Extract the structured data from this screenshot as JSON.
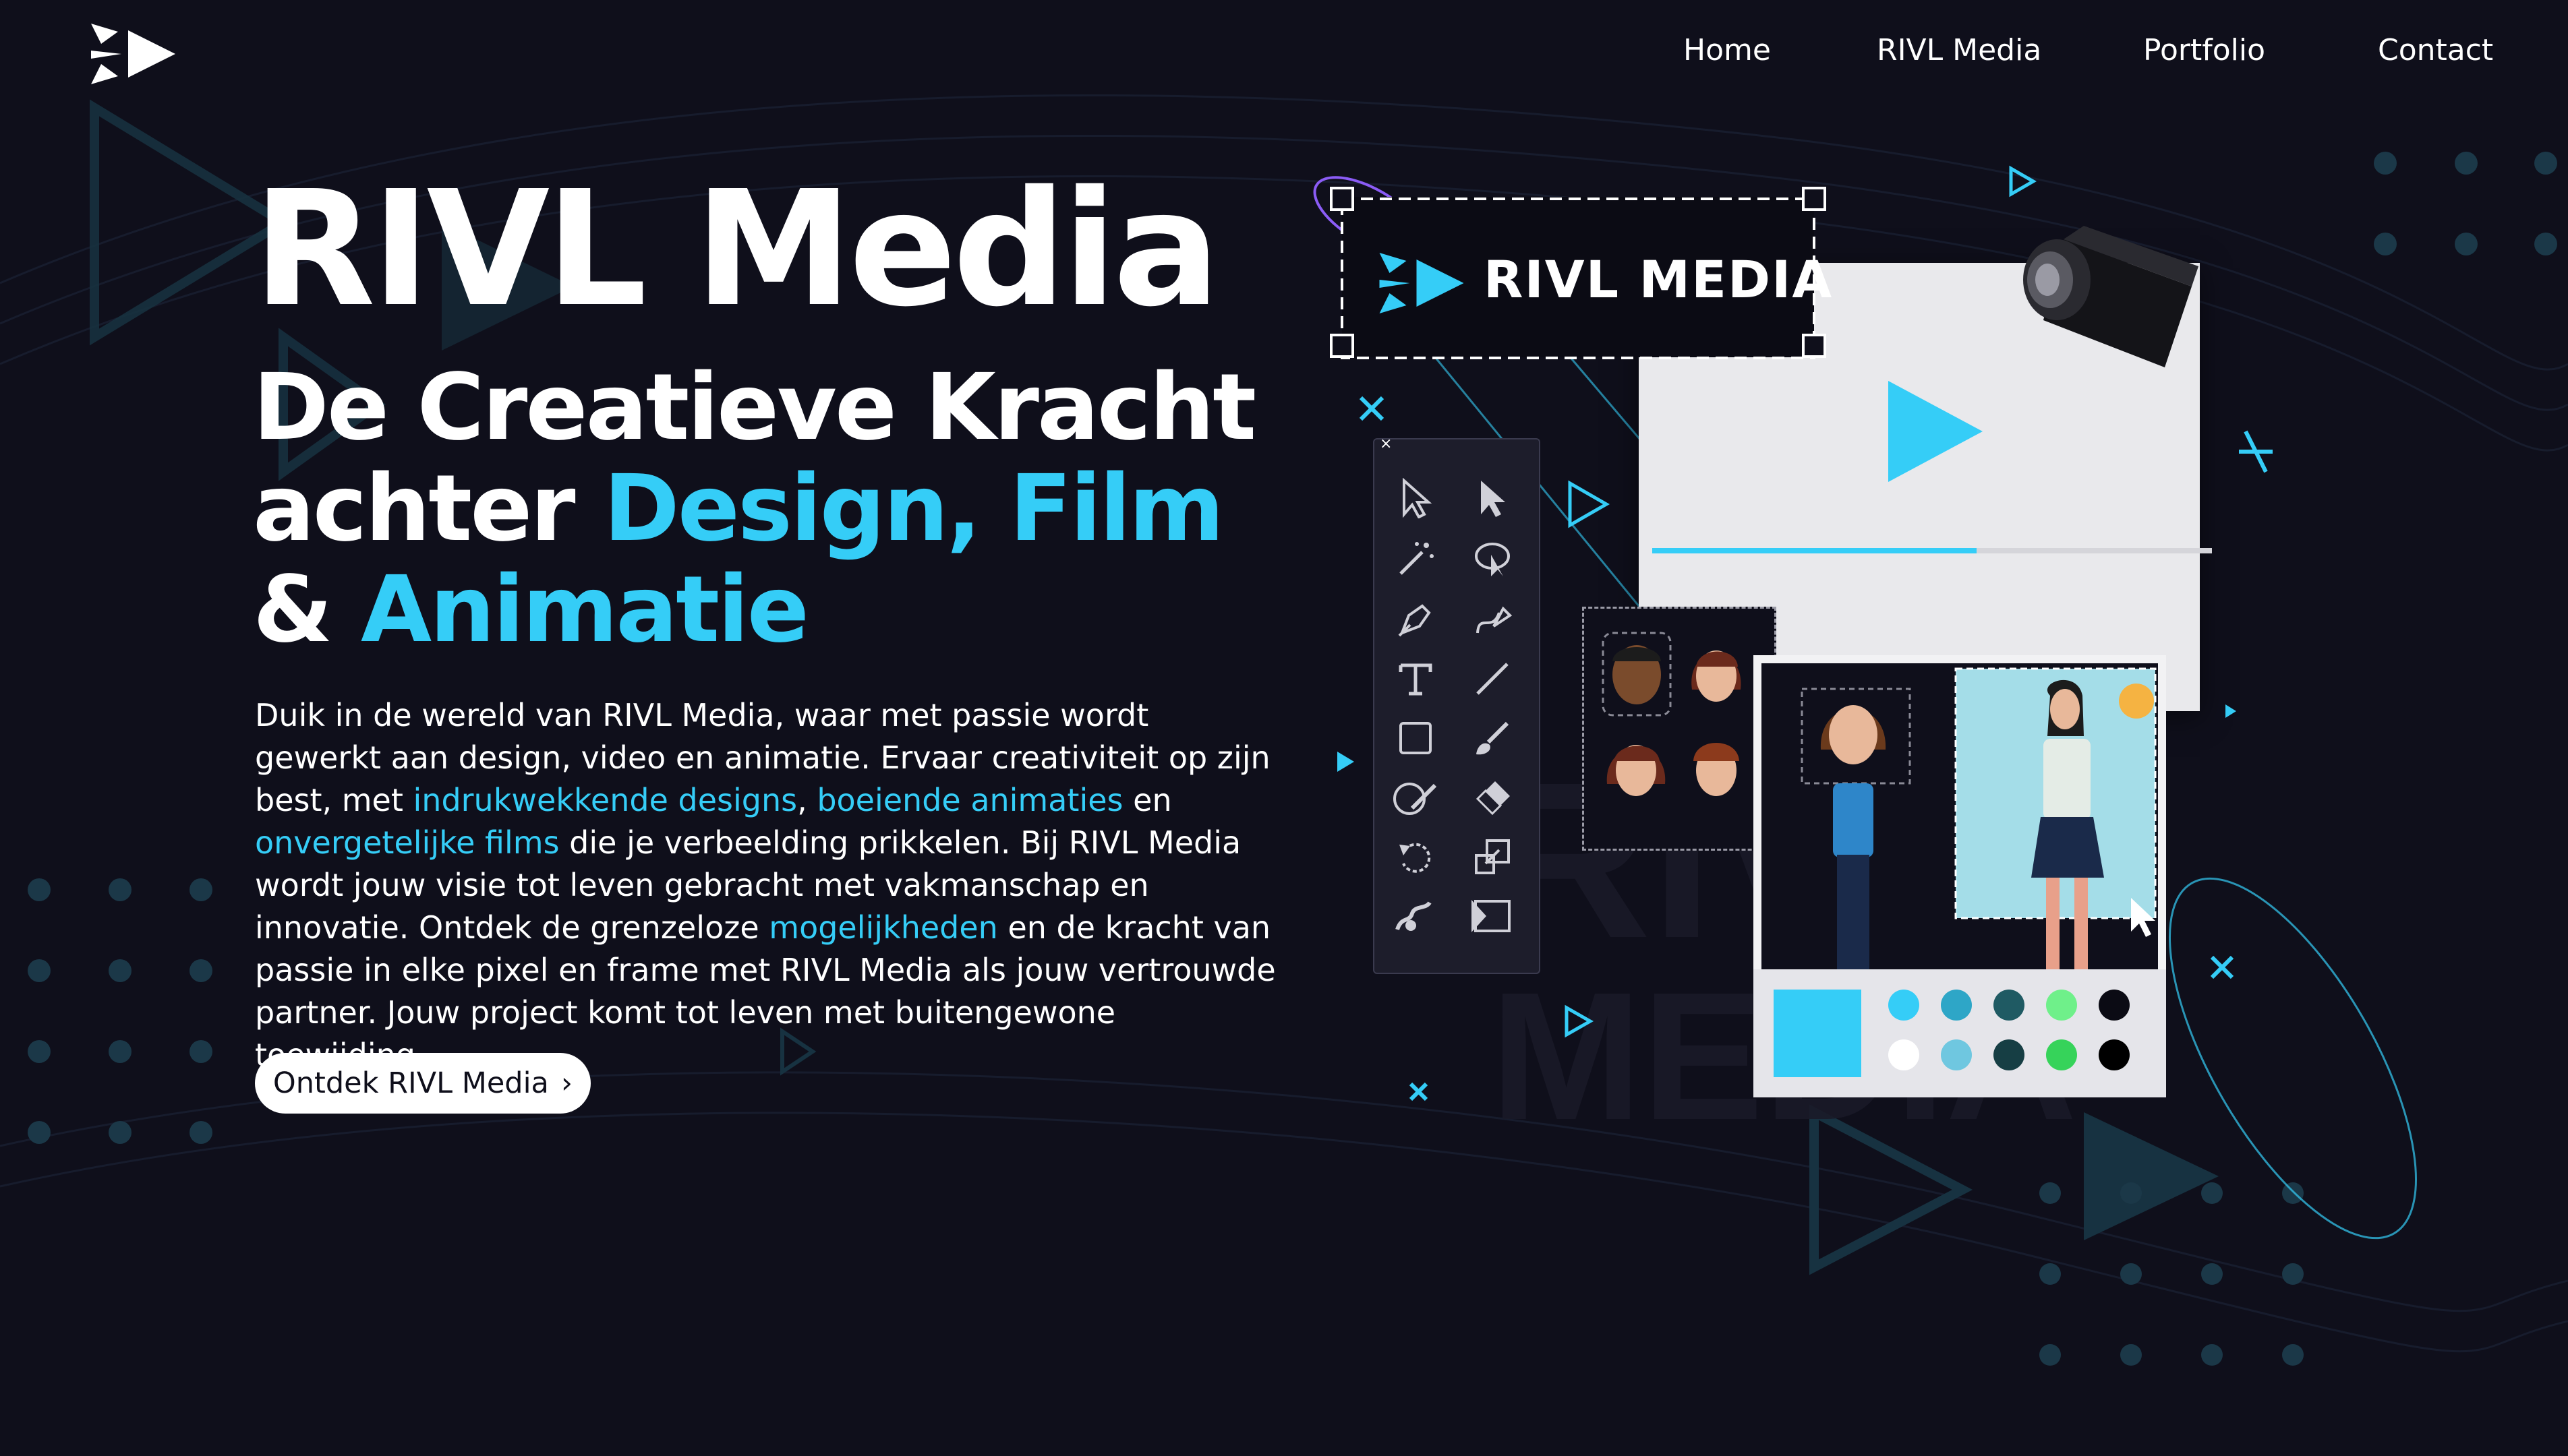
{
  "nav": {
    "home": "Home",
    "rivl_media": "RIVL Media",
    "portfolio": "Portfolio",
    "contact": "Contact"
  },
  "hero": {
    "title": "RIVL Media",
    "subtitle_part1": "De Creatieve Kracht achter ",
    "subtitle_accent1": "Design, Film",
    "subtitle_part2": " & ",
    "subtitle_accent2": "Animatie",
    "body_1": "Duik in de wereld van RIVL Media, waar met passie wordt gewerkt aan design, video en animatie. Ervaar creativiteit op zijn best, met ",
    "link_designs": "indrukwekkende designs",
    "body_sep1": ", ",
    "link_animaties": "boeiende animaties",
    "body_sep2": " en ",
    "link_films": "onvergetelijke films",
    "body_2": " die je verbeelding prikkelen. Bij RIVL Media wordt jouw visie tot leven gebracht met vakmanschap en innovatie. Ontdek de grenzeloze ",
    "link_mogelijkheden": "mogelijkheden",
    "body_3": " en de kracht van passie in elke pixel en frame met RIVL Media als jouw vertrouwde partner. Jouw project komt tot leven met buitengewone toewijding.",
    "cta_label": "Ontdek RIVL Media",
    "cta_arrow": "›"
  },
  "illustration": {
    "badge_text": "RIVL MEDIA",
    "video_progress": 0.58,
    "toolbar_close": "×",
    "tools": [
      "selection-tool",
      "direct-selection-tool",
      "magic-wand-tool",
      "lasso-tool",
      "pen-tool",
      "curvature-tool",
      "type-tool",
      "line-tool",
      "rectangle-tool",
      "brush-tool",
      "shaper-tool",
      "eraser-tool",
      "rotate-tool",
      "scale-tool",
      "puppet-warp-tool",
      "free-transform-tool"
    ],
    "palette_colors": [
      "#35cdf7",
      "#2ea6c7",
      "#1f5a63",
      "#6ff08a",
      "#0b0b14",
      "#ffffff",
      "#6fc7e0",
      "#163e44",
      "#36d35a",
      "#000000"
    ],
    "big_swatch": "#35cdf7"
  },
  "colors": {
    "accent": "#35cdf7",
    "background": "#0f0f1b",
    "text": "#ffffff"
  }
}
